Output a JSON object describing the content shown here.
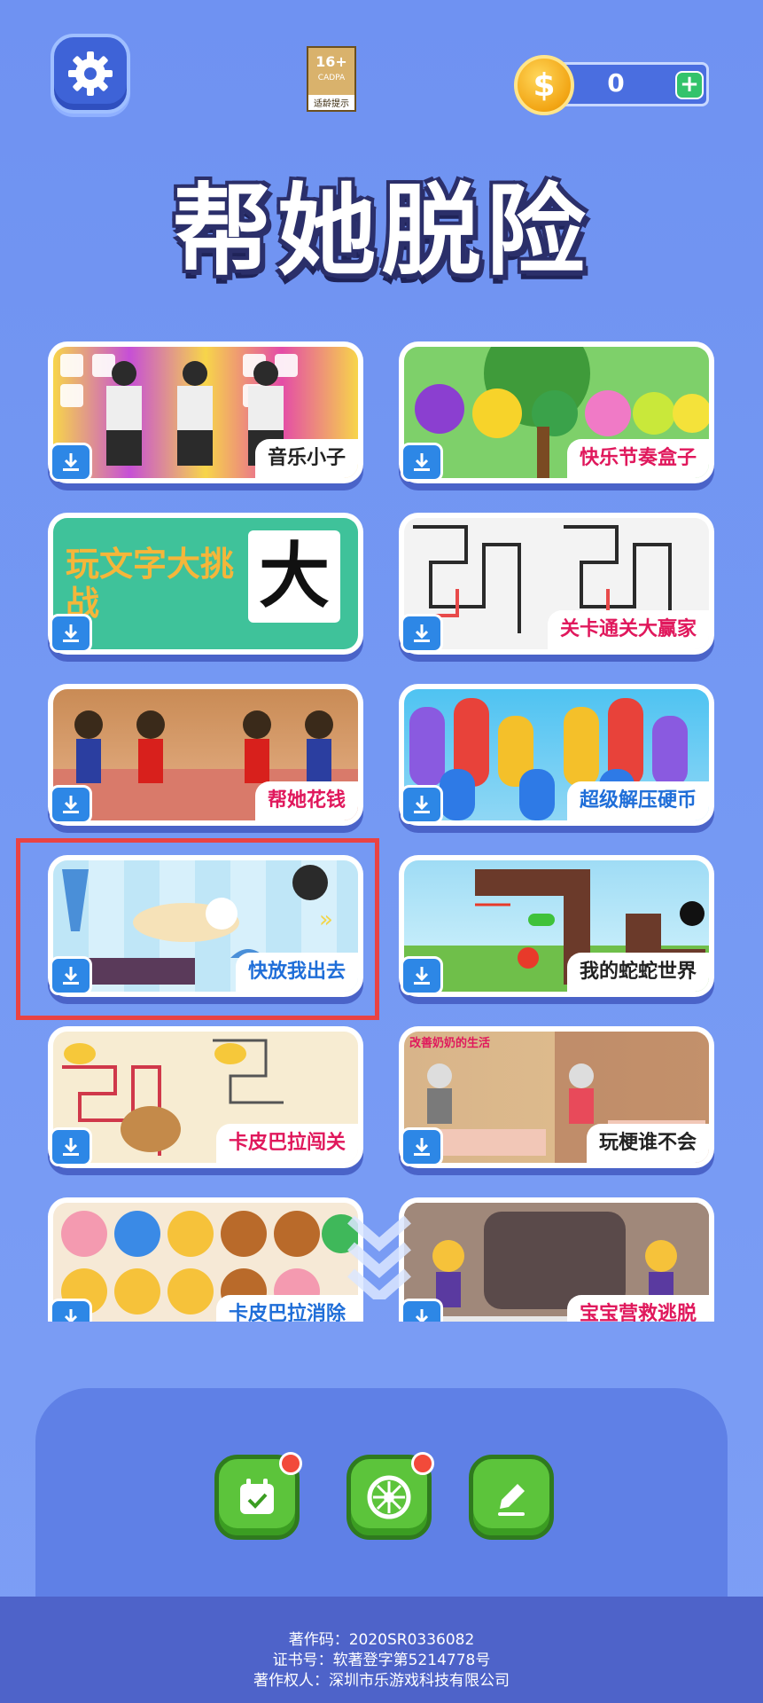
{
  "header": {
    "age_rating": "16+",
    "age_org": "CADPA",
    "age_tip": "适龄提示",
    "coin_count": "0",
    "coin_symbol": "$",
    "coin_plus": "+"
  },
  "title": "帮她脱险",
  "games": [
    {
      "label": "音乐小子"
    },
    {
      "label": "快乐节奏盒子"
    },
    {
      "label": "玩文字大挑战"
    },
    {
      "label": "关卡通关大赢家"
    },
    {
      "label": "帮她花钱"
    },
    {
      "label": "超级解压硬币"
    },
    {
      "label": "快放我出去"
    },
    {
      "label": "我的蛇蛇世界"
    },
    {
      "label": "卡皮巴拉闯关"
    },
    {
      "label": "玩梗谁不会"
    },
    {
      "label": "卡皮巴拉消除"
    },
    {
      "label": "宝宝营救逃脱"
    }
  ],
  "card_art_text": {
    "wordgame": "玩文字大挑战",
    "big_char": "大",
    "grandma": "改善奶奶的生活"
  },
  "footer": {
    "line1": "著作码：2020SR0336082",
    "line2": "证书号：软著登字第5214778号",
    "line3": "著作权人：深圳市乐游戏科技有限公司"
  },
  "colors": {
    "background": "#7599f3",
    "button_green": "#5cc43b",
    "highlight_red": "#e94343",
    "download_blue": "#2d87e6"
  },
  "icons": [
    "gear-icon",
    "coin-icon",
    "plus-icon",
    "download-icon",
    "calendar-check-icon",
    "compass-icon",
    "pencil-icon",
    "chevron-down-icon"
  ]
}
